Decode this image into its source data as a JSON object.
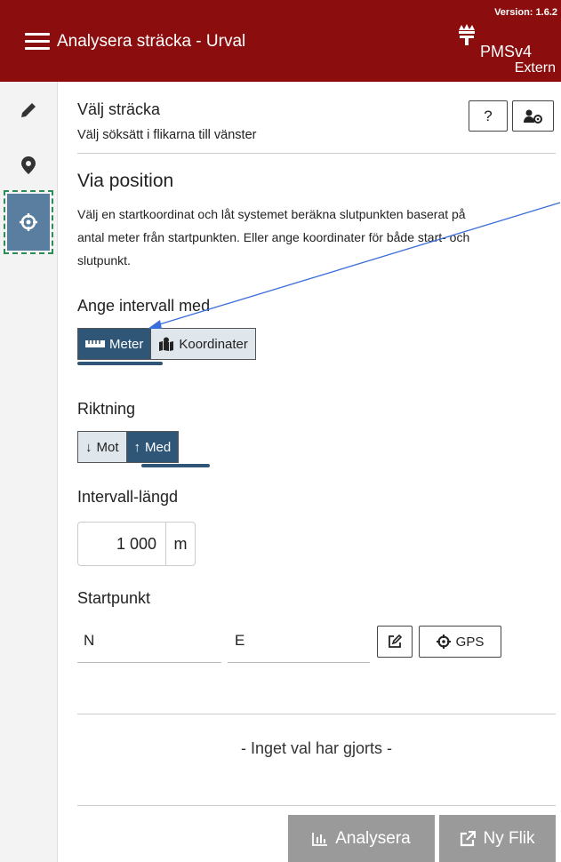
{
  "header": {
    "title": "Analysera sträcka - Urval",
    "version": "Version: 1.6.2",
    "brand": "PMSv4",
    "edition": "Extern"
  },
  "sidebar": {
    "items": [
      {
        "icon": "pencil-icon"
      },
      {
        "icon": "map-marker-icon"
      },
      {
        "icon": "crosshairs-icon",
        "active": true
      }
    ]
  },
  "panel": {
    "heading": "Välj sträcka",
    "subheading": "Välj söksätt i flikarna till vänster",
    "help_label": "?",
    "section_title": "Via position",
    "description_lines": [
      "Välj en startkoordinat och låt systemet beräkna slutpunkten baserat på",
      "antal meter från startpunkten. Eller ange koordinater för både start- och",
      "slutpunkt."
    ],
    "interval_label": "Ange intervall med",
    "interval_options": [
      "Meter",
      "Koordinater"
    ],
    "interval_selected": "Meter",
    "direction_label": "Riktning",
    "direction_options": [
      "Mot",
      "Med"
    ],
    "direction_selected": "Med",
    "length_label": "Intervall-längd",
    "length_value": "1 000",
    "length_unit": "m",
    "startpoint_label": "Startpunkt",
    "n_placeholder": "N",
    "e_placeholder": "E",
    "gps_label": "GPS",
    "empty_message": "- Inget val har gjorts -",
    "analyze_label": "Analysera",
    "new_tab_label": "Ny Flik"
  },
  "colors": {
    "header_bg": "#8b0d0d",
    "accent": "#2f5677",
    "active_tab": "#5a7ea0",
    "disabled_button": "#9a9a9a"
  }
}
